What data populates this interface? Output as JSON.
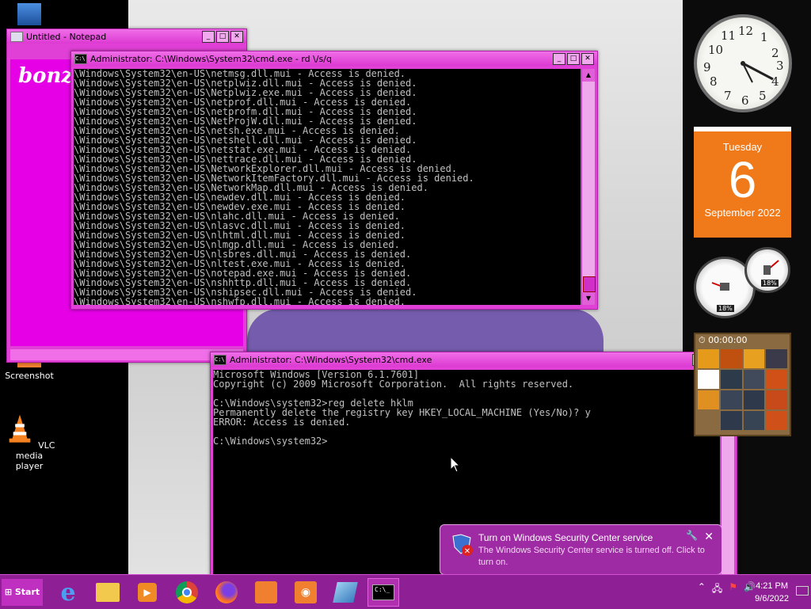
{
  "desktop": {
    "icons": [
      {
        "label": "Screenshot"
      },
      {
        "label": "VLC media player"
      }
    ]
  },
  "notepad": {
    "title": "Untitled - Notepad",
    "content": "bonzi"
  },
  "cmd1": {
    "title": "Administrator: C:\\Windows\\System32\\cmd.exe - rd \\/s/q",
    "lines": [
      "\\Windows\\System32\\en-US\\netmsg.dll.mui - Access is denied.",
      "\\Windows\\System32\\en-US\\netplwiz.dll.mui - Access is denied.",
      "\\Windows\\System32\\en-US\\Netplwiz.exe.mui - Access is denied.",
      "\\Windows\\System32\\en-US\\netprof.dll.mui - Access is denied.",
      "\\Windows\\System32\\en-US\\netprofm.dll.mui - Access is denied.",
      "\\Windows\\System32\\en-US\\NetProjW.dll.mui - Access is denied.",
      "\\Windows\\System32\\en-US\\netsh.exe.mui - Access is denied.",
      "\\Windows\\System32\\en-US\\netshell.dll.mui - Access is denied.",
      "\\Windows\\System32\\en-US\\netstat.exe.mui - Access is denied.",
      "\\Windows\\System32\\en-US\\nettrace.dll.mui - Access is denied.",
      "\\Windows\\System32\\en-US\\NetworkExplorer.dll.mui - Access is denied.",
      "\\Windows\\System32\\en-US\\NetworkItemFactory.dll.mui - Access is denied.",
      "\\Windows\\System32\\en-US\\NetworkMap.dll.mui - Access is denied.",
      "\\Windows\\System32\\en-US\\newdev.dll.mui - Access is denied.",
      "\\Windows\\System32\\en-US\\newdev.exe.mui - Access is denied.",
      "\\Windows\\System32\\en-US\\nlahc.dll.mui - Access is denied.",
      "\\Windows\\System32\\en-US\\nlasvc.dll.mui - Access is denied.",
      "\\Windows\\System32\\en-US\\nlhtml.dll.mui - Access is denied.",
      "\\Windows\\System32\\en-US\\nlmgp.dll.mui - Access is denied.",
      "\\Windows\\System32\\en-US\\nlsbres.dll.mui - Access is denied.",
      "\\Windows\\System32\\en-US\\nltest.exe.mui - Access is denied.",
      "\\Windows\\System32\\en-US\\notepad.exe.mui - Access is denied.",
      "\\Windows\\System32\\en-US\\nshhttp.dll.mui - Access is denied.",
      "\\Windows\\System32\\en-US\\nshipsec.dll.mui - Access is denied.",
      "\\Windows\\System32\\en-US\\nshwfp.dll.mui - Access is denied."
    ]
  },
  "cmd2": {
    "title": "Administrator: C:\\Windows\\System32\\cmd.exe",
    "lines": [
      "Microsoft Windows [Version 6.1.7601]",
      "Copyright (c) 2009 Microsoft Corporation.  All rights reserved.",
      "",
      "C:\\Windows\\system32>reg delete hklm",
      "Permanently delete the registry key HKEY_LOCAL_MACHINE (Yes/No)? y",
      "ERROR: Access is denied.",
      "",
      "C:\\Windows\\system32>"
    ]
  },
  "gadgets": {
    "calendar": {
      "day": "Tuesday",
      "date": "6",
      "month": "September 2022"
    },
    "cpu": {
      "cpu": "18%",
      "ram": "18%"
    },
    "puzzle_time": "00:00:00",
    "clock_numbers": [
      "12",
      "1",
      "2",
      "3",
      "4",
      "5",
      "6",
      "7",
      "8",
      "9",
      "10",
      "11"
    ]
  },
  "notification": {
    "title": "Turn on Windows Security Center service",
    "body": "The Windows Security Center service is turned off. Click to turn on."
  },
  "taskbar": {
    "start_label": "Start",
    "time": "4:21 PM",
    "date": "9/6/2022",
    "pinned": [
      "internet-explorer",
      "file-explorer",
      "media-player",
      "chrome",
      "firefox",
      "screenshot-app",
      "camera-app",
      "notepad-app",
      "cmd"
    ]
  },
  "colors": {
    "accent": "#e040d6",
    "taskbar": "#8f1f95",
    "calendar": "#f07a1a"
  }
}
